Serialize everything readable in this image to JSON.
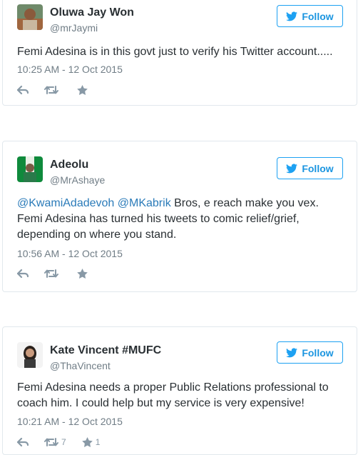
{
  "colors": {
    "link": "#2b7bb9",
    "follow": "#1b95e0",
    "muted": "#707d86"
  },
  "follow_label": "Follow",
  "tweets": [
    {
      "name": "Oluwa Jay Won",
      "handle": "@mrJaymi",
      "text": "Femi Adesina is in this govt just to verify his Twitter account.....",
      "time": "10:25 AM - 12 Oct 2015",
      "retweets": "",
      "likes": ""
    },
    {
      "name": "Adeolu",
      "handle": "@MrAshaye",
      "mention1": "@KwamiAdadevoh",
      "mention2": "@MKabrik",
      "text_rest": " Bros, e reach make you vex. Femi Adesina has turned his tweets to comic relief/grief, depending on where you stand.",
      "time": "10:56 AM - 12 Oct 2015",
      "retweets": "",
      "likes": ""
    },
    {
      "name": "Kate Vincent #MUFC",
      "handle": "@ThaVincent",
      "text": "Femi Adesina needs a proper Public Relations professional to coach him. I could help but my service is very expensive!",
      "time": "10:21 AM - 12 Oct 2015",
      "retweets": "7",
      "likes": "1"
    }
  ]
}
